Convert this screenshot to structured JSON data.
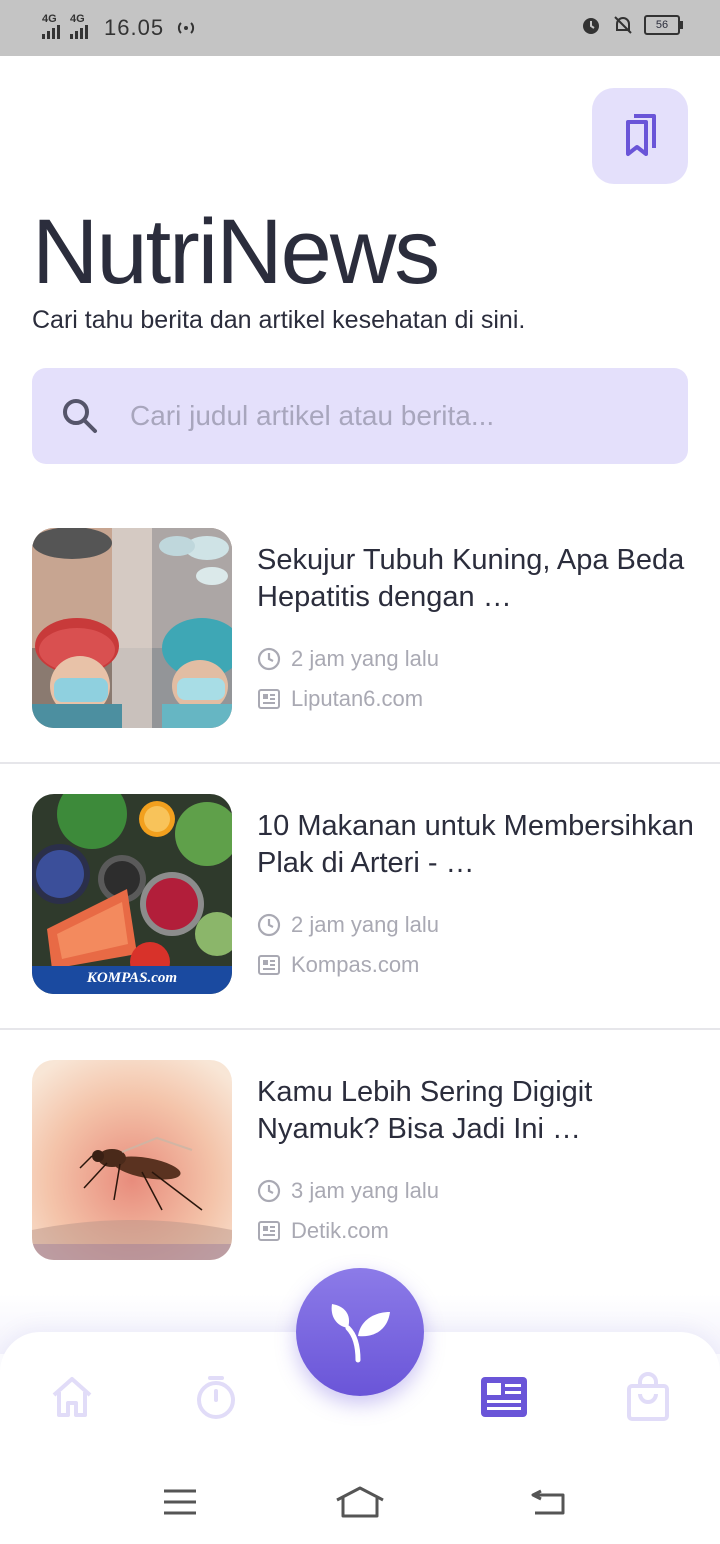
{
  "status_bar": {
    "net1": "4G",
    "net2": "4G",
    "time": "16.05",
    "battery": "56"
  },
  "header": {
    "title": "NutriNews",
    "subtitle": "Cari tahu berita dan artikel kesehatan di sini.",
    "bookmark_icon": "bookmarks-icon"
  },
  "search": {
    "placeholder": "Cari judul artikel atau berita...",
    "icon": "search-icon"
  },
  "articles": [
    {
      "title": "Sekujur Tubuh Kuning, Apa Beda Hepatitis dengan …",
      "time": "2 jam yang lalu",
      "source": "Liputan6.com"
    },
    {
      "title": "10 Makanan untuk Membersihkan Plak di Arteri - …",
      "time": "2 jam yang lalu",
      "source": "Kompas.com",
      "image_caption": "KOMPAS.com"
    },
    {
      "title": "Kamu Lebih Sering Digigit Nyamuk? Bisa Jadi Ini …",
      "time": "3 jam yang lalu",
      "source": "Detik.com"
    }
  ],
  "bottom_nav": {
    "items": [
      "home-icon",
      "timer-icon",
      "sprout-icon",
      "news-icon",
      "shopping-bag-icon"
    ],
    "active": "news-icon",
    "accent": "#6a55d8",
    "inactive": "#e1dcf8"
  }
}
